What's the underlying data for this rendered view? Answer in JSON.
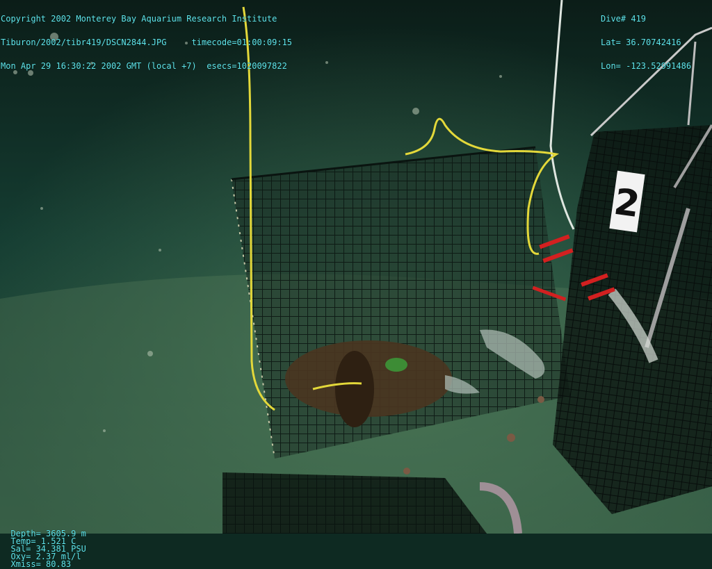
{
  "overlay": {
    "top_left": [
      "Copyright 2002 Monterey Bay Aquarium Research Institute",
      "Tiburon/2002/tibr419/DSCN2844.JPG     timecode=01:00:09:15",
      "Mon Apr 29 16:30:22 2002 GMT (local +7)  esecs=1020097822"
    ],
    "top_right": [
      "Dive# 419",
      "Lat= 36.70742416",
      "Lon= -123.52991486"
    ],
    "bottom": {
      "depth": "Depth= 3605.9 m",
      "temp": "Temp= 1.521 C",
      "sal": "Sal= 34.381 PSU",
      "oxy": "Oxy= 2.37 ml/l",
      "xmiss": "Xmiss= 80.83"
    }
  },
  "trap_number_label": "2"
}
